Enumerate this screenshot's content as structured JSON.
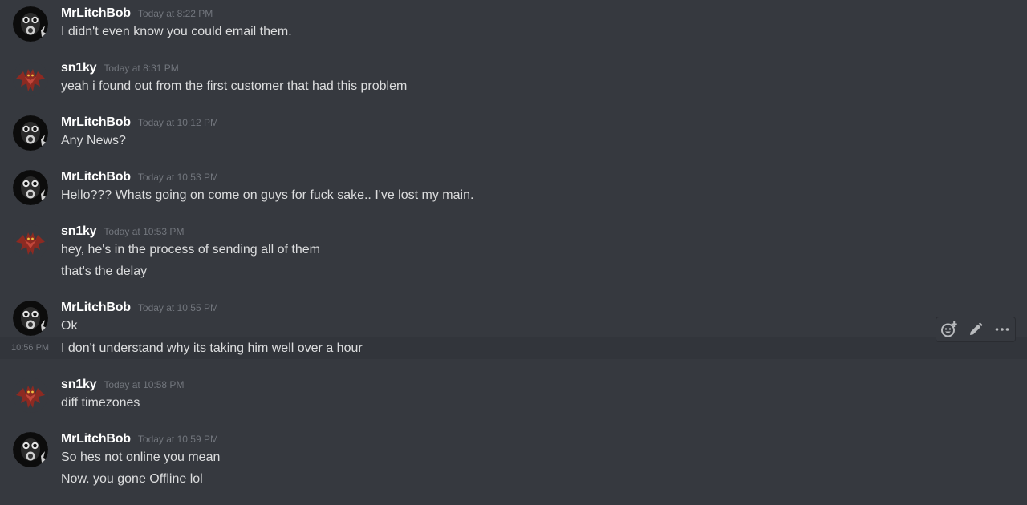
{
  "messages": [
    {
      "username": "MrLitchBob",
      "timestamp": "Today at 8:22 PM",
      "avatar_icon": "gas-mask-avatar-icon",
      "lines": [
        "I didn't even know you could email them."
      ]
    },
    {
      "username": "sn1ky",
      "timestamp": "Today at 8:31 PM",
      "avatar_icon": "red-demon-avatar-icon",
      "lines": [
        "yeah i found out from the first customer that had this problem"
      ]
    },
    {
      "username": "MrLitchBob",
      "timestamp": "Today at 10:12 PM",
      "avatar_icon": "gas-mask-avatar-icon",
      "lines": [
        "Any News?"
      ]
    },
    {
      "username": "MrLitchBob",
      "timestamp": "Today at 10:53 PM",
      "avatar_icon": "gas-mask-avatar-icon",
      "lines": [
        "Hello??? Whats going on come on guys for fuck sake.. I've lost my main."
      ]
    },
    {
      "username": "sn1ky",
      "timestamp": "Today at 10:53 PM",
      "avatar_icon": "red-demon-avatar-icon",
      "lines": [
        "hey, he's in the process of sending all of them",
        "that's the delay"
      ]
    },
    {
      "username": "MrLitchBob",
      "timestamp": "Today at 10:55 PM",
      "avatar_icon": "gas-mask-avatar-icon",
      "lines": [
        "Ok",
        "I don't understand why its taking him well over a hour"
      ]
    },
    {
      "username": "sn1ky",
      "timestamp": "Today at 10:58 PM",
      "avatar_icon": "red-demon-avatar-icon",
      "lines": [
        "diff timezones"
      ]
    },
    {
      "username": "MrLitchBob",
      "timestamp": "Today at 10:59 PM",
      "avatar_icon": "gas-mask-avatar-icon",
      "lines": [
        "So hes not online you mean",
        "Now. you gone Offline lol"
      ]
    }
  ],
  "hovered_message": {
    "time": "10:56 PM"
  },
  "toolbar": {
    "icons": [
      "add-reaction-icon",
      "edit-pencil-icon",
      "more-options-icon"
    ]
  },
  "colors": {
    "background": "#36393f",
    "hover_background": "#32353b",
    "username": "#ffffff",
    "timestamp": "#72767d",
    "message_text": "#dcddde",
    "icon": "#b9bbbe"
  }
}
